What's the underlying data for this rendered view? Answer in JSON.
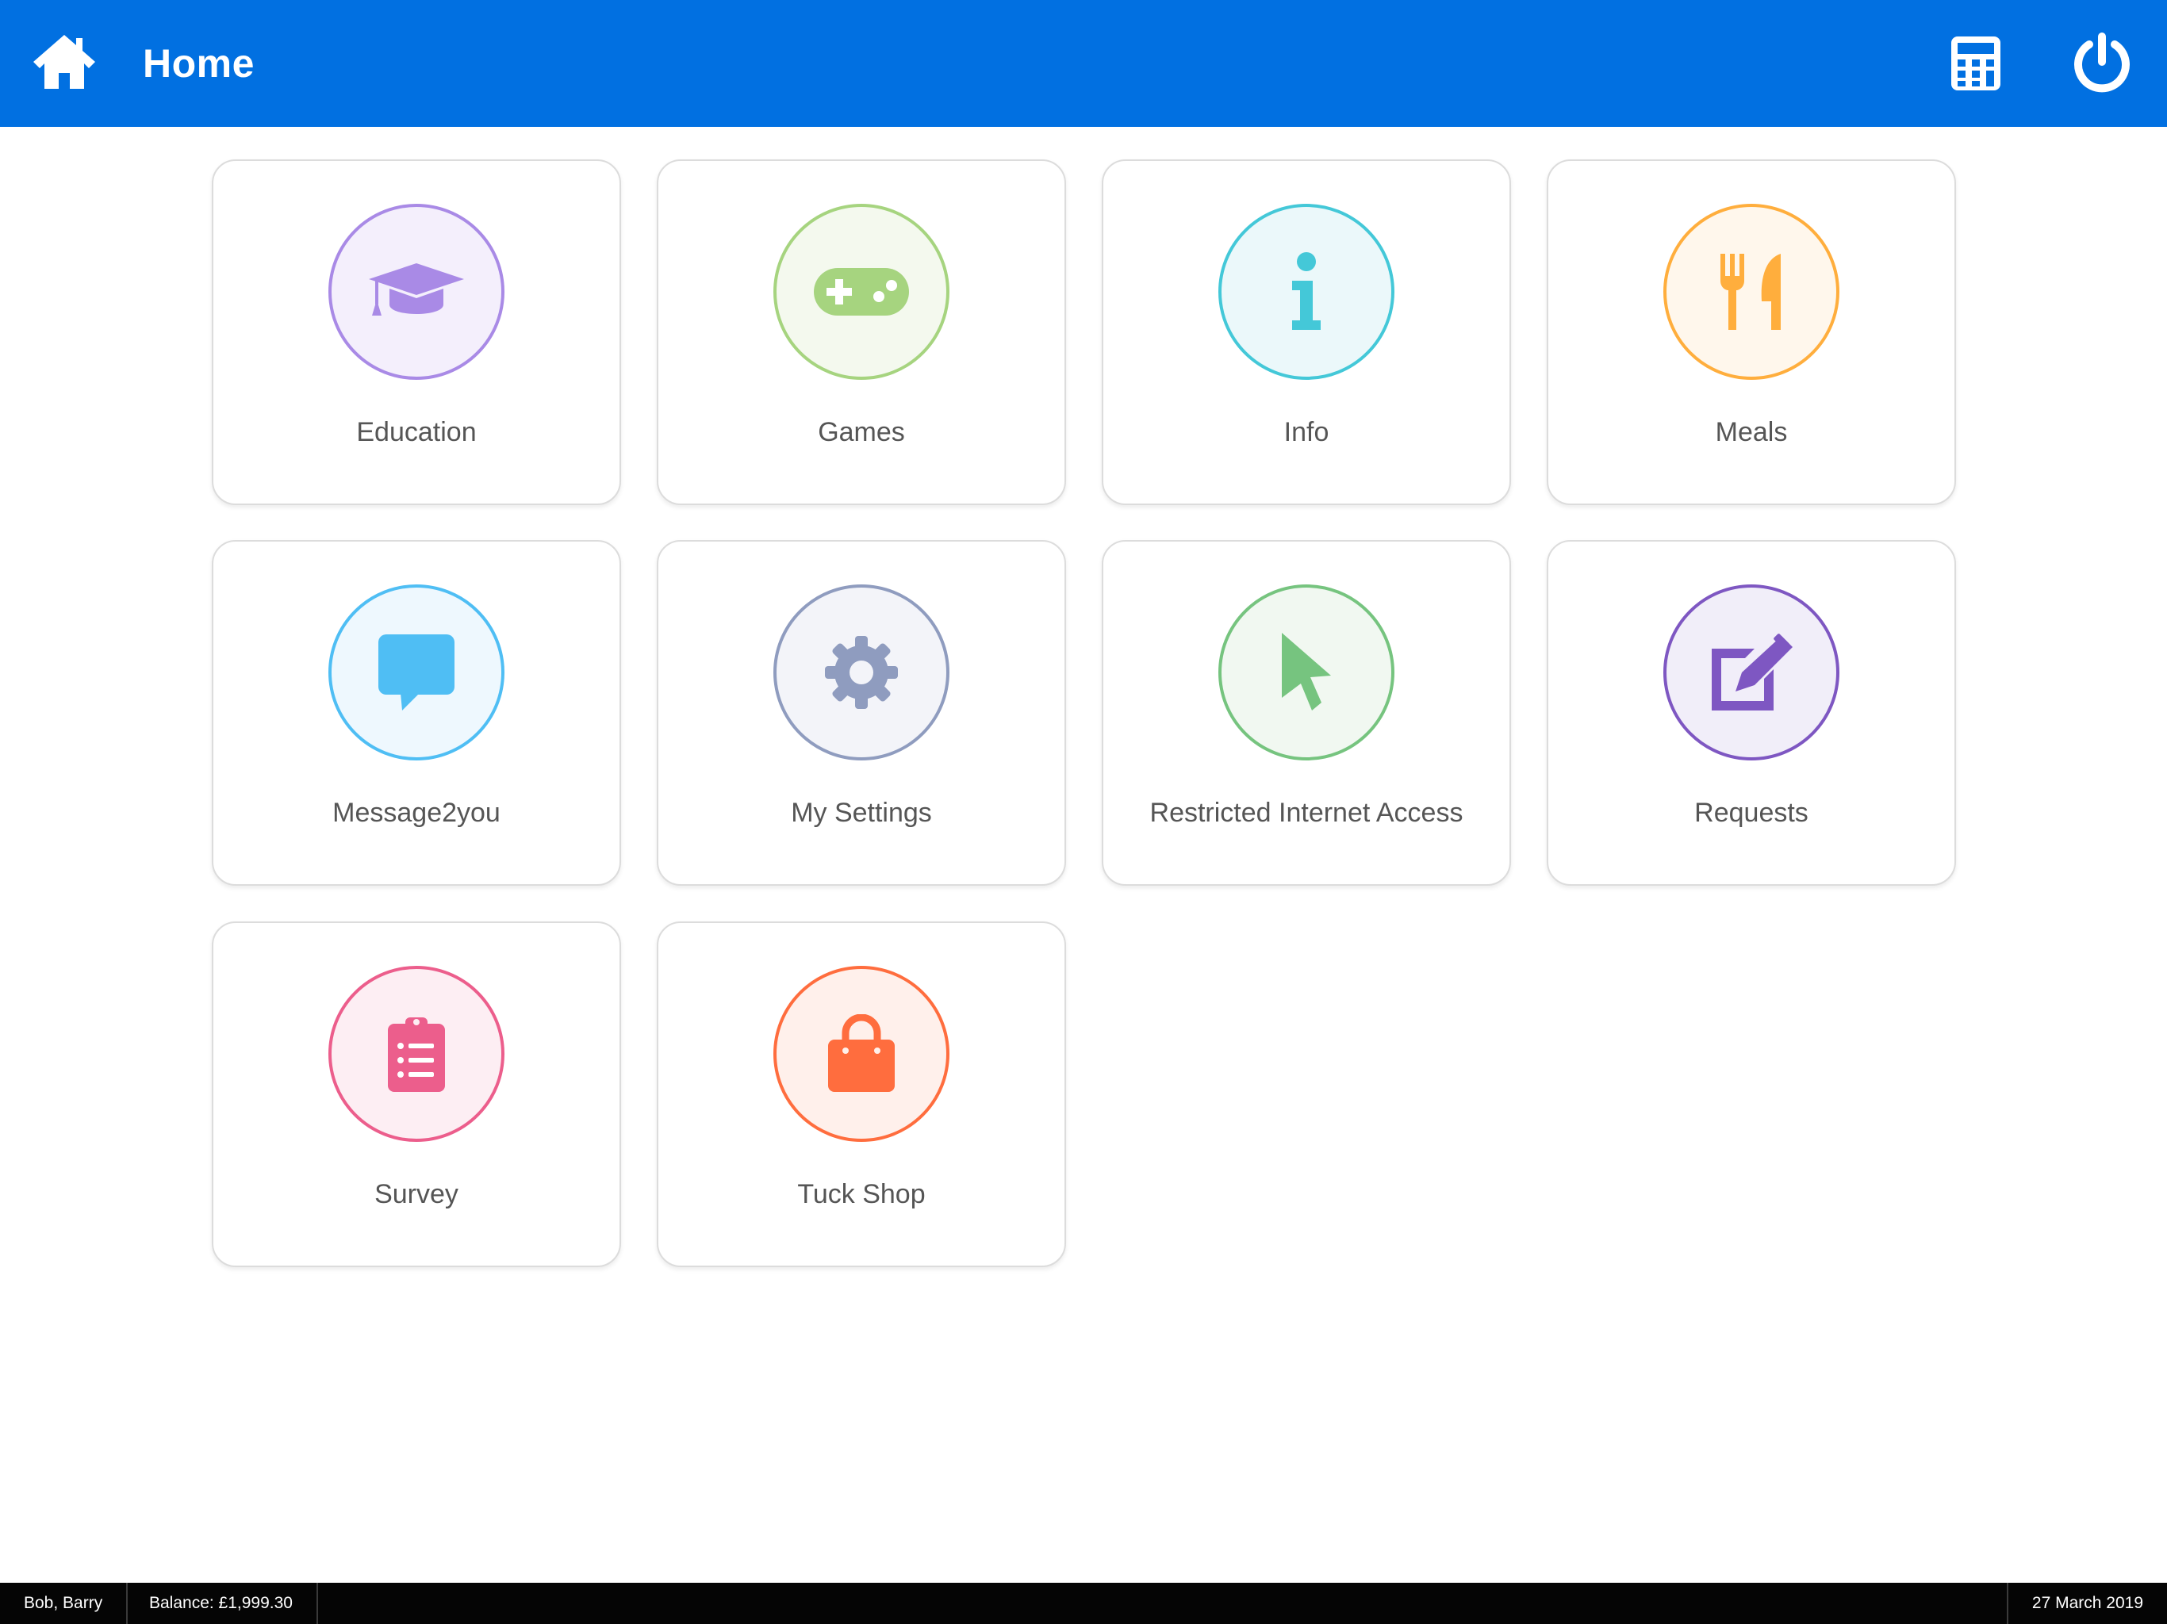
{
  "header": {
    "title": "Home",
    "home_icon": "home-icon",
    "calculator_icon": "calculator-icon",
    "power_icon": "power-icon",
    "color": "#0170e1"
  },
  "tiles": [
    {
      "label": "Education",
      "icon": "graduation-cap-icon",
      "color": "#a98ae6"
    },
    {
      "label": "Games",
      "icon": "gamepad-icon",
      "color": "#a6d47f"
    },
    {
      "label": "Info",
      "icon": "info-icon",
      "color": "#44c8d8"
    },
    {
      "label": "Meals",
      "icon": "utensils-icon",
      "color": "#ffae3d"
    },
    {
      "label": "Message2you",
      "icon": "chat-bubble-icon",
      "color": "#4fbef4"
    },
    {
      "label": "My Settings",
      "icon": "gear-icon",
      "color": "#8f9cbf"
    },
    {
      "label": "Restricted Internet Access",
      "icon": "mouse-pointer-icon",
      "color": "#76c47f"
    },
    {
      "label": "Requests",
      "icon": "edit-icon",
      "color": "#7e57c2"
    },
    {
      "label": "Survey",
      "icon": "clipboard-list-icon",
      "color": "#ec5e8c"
    },
    {
      "label": "Tuck Shop",
      "icon": "shopping-bag-icon",
      "color": "#ff6d3e"
    }
  ],
  "footer": {
    "user": "Bob, Barry",
    "balance": "Balance: £1,999.30",
    "date": "27 March 2019"
  }
}
